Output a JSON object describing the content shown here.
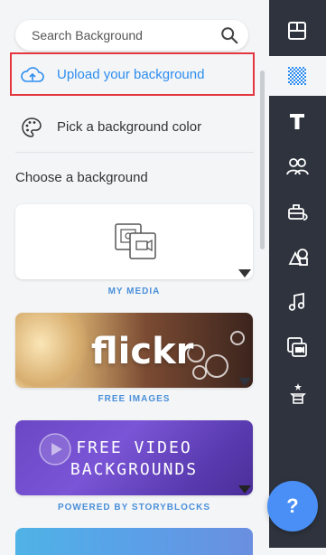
{
  "search": {
    "placeholder": "Search Background"
  },
  "upload": {
    "label": "Upload your background"
  },
  "pick_color": {
    "label": "Pick a background color"
  },
  "choose": {
    "label": "Choose a background"
  },
  "cards": [
    {
      "id": "my_media",
      "caption": "MY MEDIA"
    },
    {
      "id": "flickr",
      "title": "flickr",
      "caption": "FREE IMAGES"
    },
    {
      "id": "storyblocks",
      "line1": "FREE VIDEO",
      "line2": "BACKGROUNDS",
      "caption": "POWERED BY STORYBLOCKS"
    }
  ],
  "help": {
    "label": "?"
  },
  "rail": {
    "items": [
      {
        "name": "layout-icon"
      },
      {
        "name": "background-icon"
      },
      {
        "name": "text-icon"
      },
      {
        "name": "characters-icon"
      },
      {
        "name": "props-icon"
      },
      {
        "name": "shapes-icon"
      },
      {
        "name": "music-icon"
      },
      {
        "name": "video-icon"
      },
      {
        "name": "effects-icon"
      }
    ]
  },
  "colors": {
    "accent": "#2c8df0",
    "highlight_border": "#e4363f",
    "rail_bg": "#2e333d",
    "help_button": "#4a8ff5"
  }
}
